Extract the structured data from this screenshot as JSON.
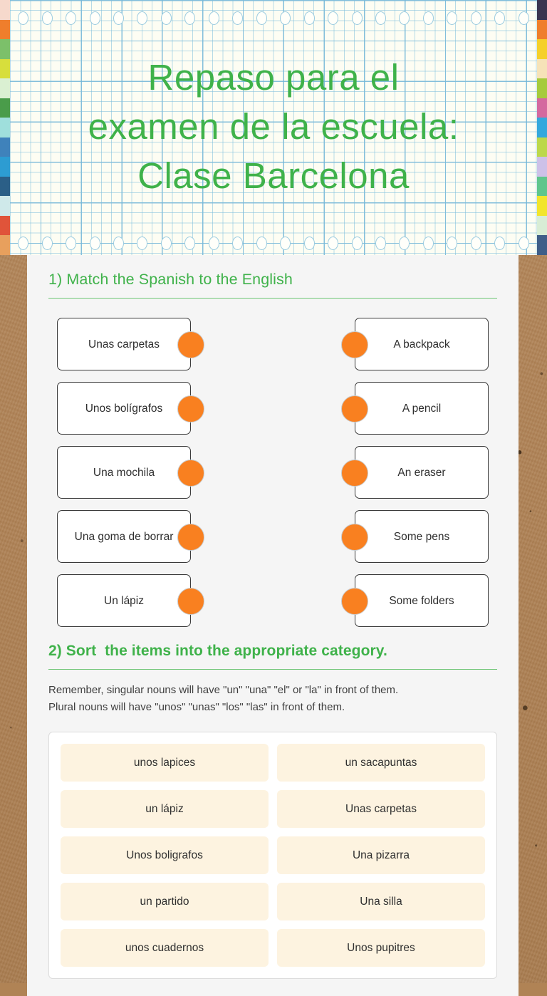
{
  "background": {
    "surface": "cork-board",
    "cork_color": "#b2855a",
    "sheet_color": "#f5f5f5"
  },
  "header": {
    "title": "Repaso para el\nexamen de la escuela:\nClase Barcelona",
    "paper_style": "graph-paper",
    "paper_color": "#fdfdf3",
    "grid_color": "#7dbedc",
    "accent_green": "#3fb24a",
    "hole_count": 22,
    "left_tab_colors": [
      "#f6d9cc",
      "#ef7e2c",
      "#7cc06a",
      "#d7de3c",
      "#daf0d2",
      "#4a9c4a",
      "#9fdfdc",
      "#3f82bb",
      "#2d9cd2",
      "#2b5f87",
      "#cfe9ea",
      "#e0543a",
      "#e8a05d"
    ],
    "right_tab_colors": [
      "#3a3550",
      "#ef7e2c",
      "#f5d02a",
      "#f6e3b8",
      "#a6cb3c",
      "#d4699f",
      "#33a8dd",
      "#bcd84a",
      "#cdc1e8",
      "#5fc68c",
      "#f2e52c",
      "#d8edd5",
      "#3f5e88"
    ]
  },
  "questions": [
    {
      "number": "1)",
      "heading": "1) Match the Spanish to the English",
      "type": "matching",
      "connector_color": "#f98020",
      "pairs": [
        {
          "spanish": "Unas carpetas",
          "english": "A backpack"
        },
        {
          "spanish": "Unos bolígrafos",
          "english": "A pencil"
        },
        {
          "spanish": "Una mochila",
          "english": "An eraser"
        },
        {
          "spanish": "Una goma de borrar",
          "english": "Some pens"
        },
        {
          "spanish": "Un lápiz",
          "english": "Some folders"
        }
      ]
    },
    {
      "number": "2)",
      "heading": "2) Sort  the items into the appropriate category.",
      "type": "sorting",
      "hint": "Remember, singular nouns will have \"un\" \"una\" \"el\" or \"la\" in front of them.\nPlural nouns will have \"unos\" \"unas\" \"los\" \"las\" in front of them.",
      "item_color": "#fdf3e0",
      "items": [
        "unos lapices",
        "un sacapuntas",
        "un lápiz",
        "Unas carpetas",
        "Unos boligrafos",
        "Una pizarra",
        "un partido",
        "Una silla",
        "unos cuadernos",
        "Unos pupitres"
      ]
    }
  ]
}
